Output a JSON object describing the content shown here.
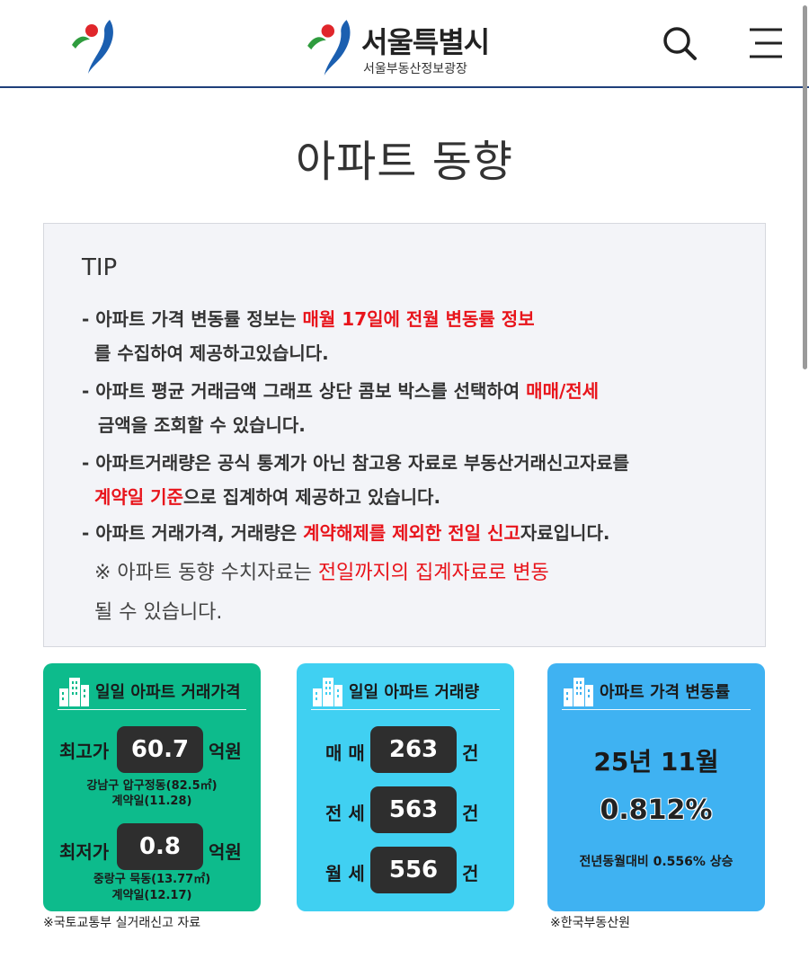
{
  "header": {
    "brand_title": "서울특별시",
    "brand_subtitle": "서울부동산정보광장",
    "icons": {
      "emblem": "seoul-emblem-icon",
      "search": "search-icon",
      "menu": "menu-icon"
    },
    "colors": {
      "border": "#1f3f7a",
      "emblem_red": "#e0262b",
      "emblem_green": "#2f9c3e",
      "emblem_blue": "#1b5fb0"
    }
  },
  "page_title": "아파트 동향",
  "tip": {
    "title": "TIP",
    "line1_a": "- 아파트 가격 변동률 정보는 ",
    "line1_red": "매월 17일에 전월 변동률 정보",
    "line1_b": "를 수집하여 제공하고있습니다.",
    "line2_a": "- 아파트 평균 거래금액 그래프 상단 콤보 박스를 선택하여 ",
    "line2_red": "매매/전세",
    "line2_b": "금액을 조회할 수 있습니다.",
    "line3_a": "- 아파트거래량은 공식 통계가 아닌 참고용 자료로 부동산거래신고자료를",
    "line3_red": "계약일 기준",
    "line3_b": "으로 집계하여 제공하고 있습니다.",
    "line4_a": "- 아파트 거래가격, 거래량은 ",
    "line4_red": "계약해제를 제외한 전일 신고",
    "line4_b": "자료입니다.",
    "note_a": "※ 아파트 동향 수치자료는 ",
    "note_red": "전일까지의 집계자료로 변동",
    "note_b": "될 수 있습니다.",
    "highlight_color": "#e8141b"
  },
  "cards": {
    "price": {
      "title": "일일 아파트 거래가격",
      "max_label": "최고가",
      "max_value": "60.7",
      "max_unit": "억원",
      "max_location": "강남구 압구정동(82.5㎡)",
      "max_date": "계약일(11.28)",
      "min_label": "최저가",
      "min_value": "0.8",
      "min_unit": "억원",
      "min_location": "중랑구 묵동(13.77㎡)",
      "min_date": "계약일(12.17)",
      "source": "※국토교통부 실거래신고 자료",
      "color": "#0dbb8c"
    },
    "volume": {
      "title": "일일 아파트 거래량",
      "rows": [
        {
          "label": "매 매",
          "value": "263",
          "unit": "건"
        },
        {
          "label": "전 세",
          "value": "563",
          "unit": "건"
        },
        {
          "label": "월 세",
          "value": "556",
          "unit": "건"
        }
      ],
      "color": "#40d0f2"
    },
    "rate": {
      "title": "아파트 가격 변동률",
      "month": "25년 11월",
      "rate": "0.812%",
      "compare": "전년동월대비   0.556% 상승",
      "source": "※한국부동산원",
      "color": "#3fb2f2"
    },
    "building_icon": "building-icon"
  }
}
